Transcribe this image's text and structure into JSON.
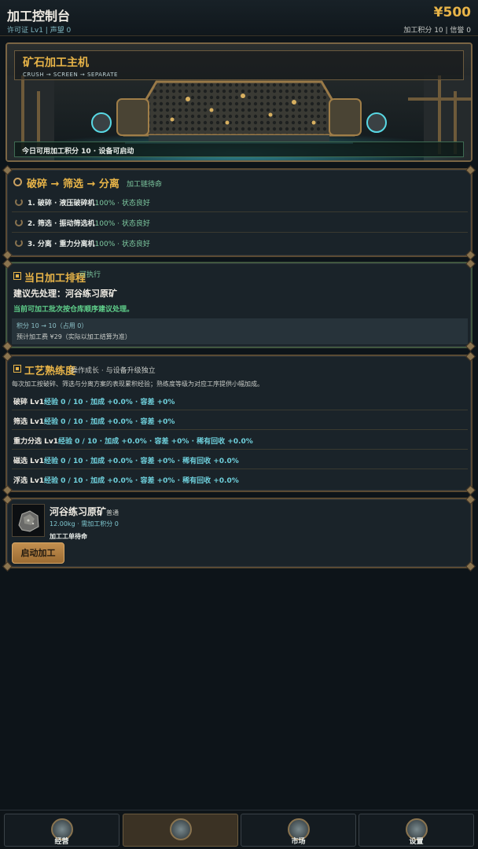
{
  "header": {
    "title": "加工控制台",
    "license": "许可证 Lv1 | 声望 0",
    "money": "¥500",
    "points": "加工积分 10 | 信誉 0"
  },
  "hero": {
    "title": "矿石加工主机",
    "subtitle": "CRUSH → SCREEN → SEPARATE",
    "status": "今日可用加工积分 10 · 设备可启动"
  },
  "chain": {
    "title": "破碎 → 筛选 → 分离",
    "tag": "加工链待命",
    "steps": [
      {
        "label": "1. 破碎 · 液压破碎机",
        "pct": "100% · 状态良好"
      },
      {
        "label": "2. 筛选 · 振动筛选机",
        "pct": "100% · 状态良好"
      },
      {
        "label": "3. 分离 · 重力分离机",
        "pct": "100% · 状态良好"
      }
    ]
  },
  "schedule": {
    "title": "当日加工排程",
    "tag": "可执行",
    "suggest": "建议先处理：河谷练习原矿",
    "note": "当前可加工批次按仓库顺序建议处理。",
    "points": "积分 10 → 10（占用 0）",
    "fee": "预计加工费 ¥29（实际以加工结算为准）"
  },
  "skill": {
    "title": "工艺熟练度",
    "tag": "操作成长 · 与设备升级独立",
    "desc": "每次加工按破碎、筛选与分离方案的表现累积经验；熟练度等级为对应工序提供小幅加成。",
    "rows": [
      {
        "name": "破碎 Lv1",
        "val": "经验 0 / 10 · 加成 +0.0% · 容差 +0%"
      },
      {
        "name": "筛选 Lv1",
        "val": "经验 0 / 10 · 加成 +0.0% · 容差 +0%"
      },
      {
        "name": "重力分选 Lv1",
        "val": "经验 0 / 10 · 加成 +0.0% · 容差 +0% · 稀有回收 +0.0%"
      },
      {
        "name": "磁选 Lv1",
        "val": "经验 0 / 10 · 加成 +0.0% · 容差 +0% · 稀有回收 +0.0%"
      },
      {
        "name": "浮选 Lv1",
        "val": "经验 0 / 10 · 加成 +0.0% · 容差 +0% · 稀有回收 +0.0%"
      }
    ]
  },
  "ore": {
    "name": "河谷练习原矿",
    "grade": "普通",
    "info": "12.00kg · 需加工积分 0",
    "status": "加工工单待命",
    "button": "启动加工"
  },
  "nav": {
    "items": [
      {
        "label": "经营",
        "icon": "business-icon"
      },
      {
        "label": "",
        "icon": "processing-icon"
      },
      {
        "label": "市场",
        "icon": "market-icon"
      },
      {
        "label": "设置",
        "icon": "settings-icon"
      }
    ]
  },
  "colors": {
    "accent": "#e8b448",
    "good": "#7ec9a0",
    "cyan": "#6fd0dc",
    "bg": "#0d1419"
  }
}
